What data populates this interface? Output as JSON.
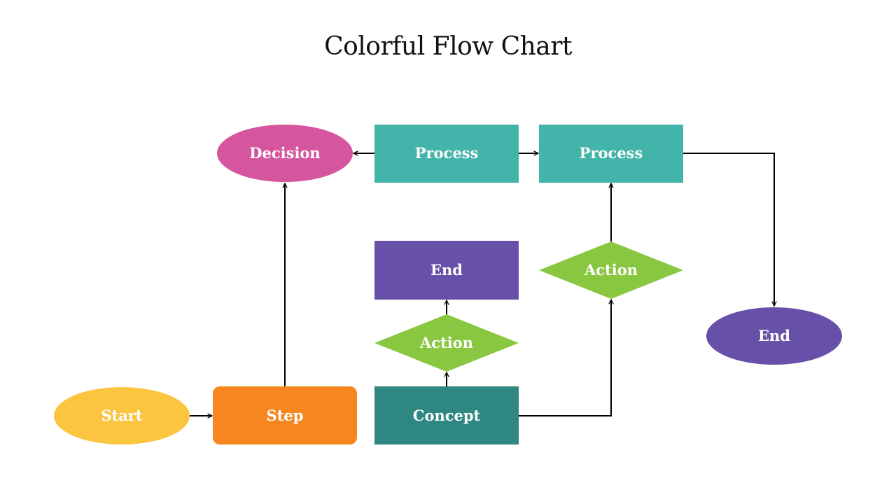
{
  "title": "Colorful Flow Chart",
  "colors": {
    "yellow": "#FBC540",
    "orange": "#F58620",
    "teal_dark": "#2E8780",
    "teal": "#42B4A9",
    "pink": "#D6559F",
    "purple": "#6650A8",
    "green": "#8AC740",
    "connector": "#000000"
  },
  "nodes": {
    "start": {
      "label": "Start",
      "shape": "ellipse",
      "color": "#FBC540"
    },
    "step": {
      "label": "Step",
      "shape": "rounded-rect",
      "color": "#F58620"
    },
    "concept": {
      "label": "Concept",
      "shape": "rect",
      "color": "#2E8780"
    },
    "action1": {
      "label": "Action",
      "shape": "diamond",
      "color": "#8AC740"
    },
    "end1": {
      "label": "End",
      "shape": "rect",
      "color": "#6650A8"
    },
    "decision": {
      "label": "Decision",
      "shape": "ellipse",
      "color": "#D6559F"
    },
    "process1": {
      "label": "Process",
      "shape": "rect",
      "color": "#42B4A9"
    },
    "process2": {
      "label": "Process",
      "shape": "rect",
      "color": "#42B4A9"
    },
    "action2": {
      "label": "Action",
      "shape": "diamond",
      "color": "#8AC740"
    },
    "end2": {
      "label": "End",
      "shape": "ellipse",
      "color": "#6650A8"
    }
  },
  "edges": [
    {
      "from": "start",
      "to": "step"
    },
    {
      "from": "step",
      "to": "decision"
    },
    {
      "from": "process1",
      "to": "decision"
    },
    {
      "from": "process1",
      "to": "process2"
    },
    {
      "from": "concept",
      "to": "action1"
    },
    {
      "from": "action1",
      "to": "end1"
    },
    {
      "from": "concept",
      "to": "action2"
    },
    {
      "from": "action2",
      "to": "process2"
    },
    {
      "from": "process2",
      "to": "end2"
    }
  ]
}
